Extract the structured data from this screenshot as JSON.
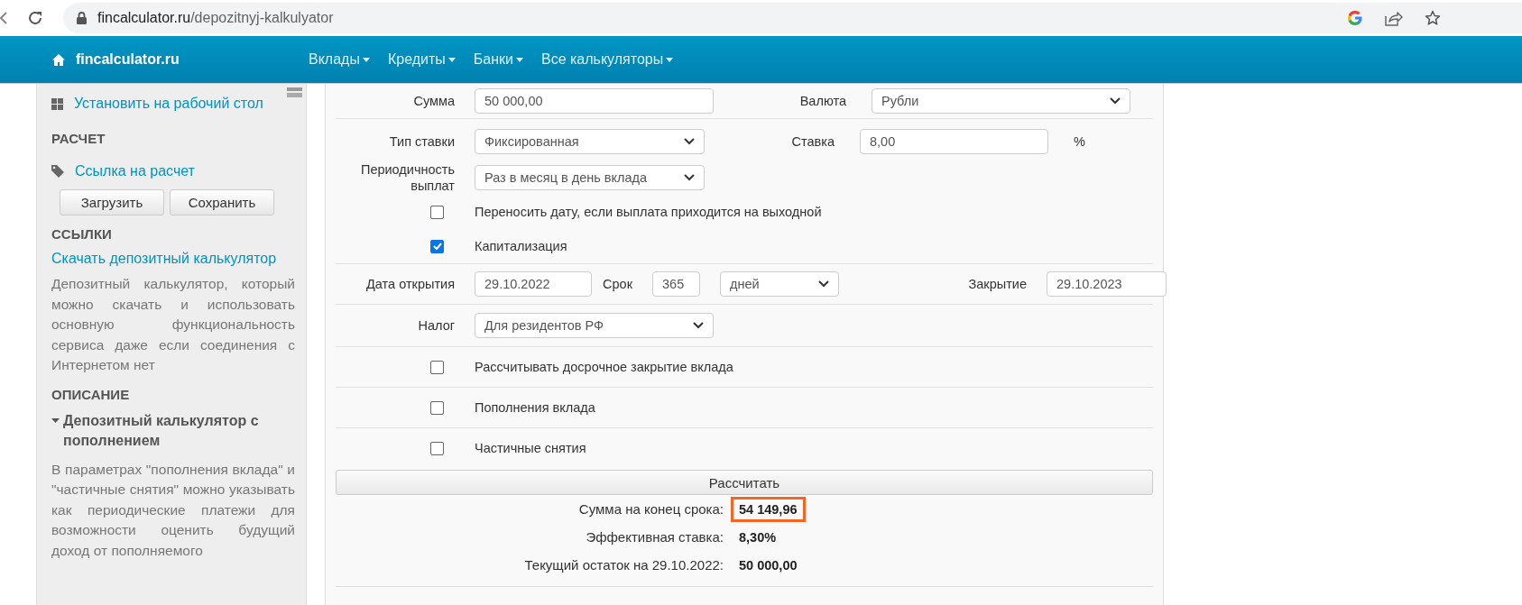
{
  "browser": {
    "url_host": "fincalculator.ru",
    "url_path": "/depozitnyj-kalkulyator"
  },
  "navbar": {
    "brand": "fincalculator.ru",
    "menu": [
      "Вклады",
      "Кредиты",
      "Банки",
      "Все калькуляторы"
    ]
  },
  "sidebar": {
    "install_link": "Установить на рабочий стол",
    "calc_heading": "РАСЧЕТ",
    "calc_link": "Ссылка на расчет",
    "buttons": [
      "Загрузить",
      "Сохранить"
    ],
    "links_heading": "ССЫЛКИ",
    "download_link": "Скачать депозитный калькулятор",
    "download_text": "Депозитный калькулятор, который можно скачать и использовать основную функциональность сервиса даже если соединения с Интернетом нет",
    "desc_heading": "ОПИСАНИЕ",
    "desc_title": "Депозитный калькулятор с пополнением",
    "desc_text": "В параметрах \"пополнения вклада\" и \"частичные снятия\" можно указывать как периодические платежи для возможности оценить будущий доход от пополняемого"
  },
  "form": {
    "amount": {
      "label": "Сумма",
      "value": "50 000,00"
    },
    "currency": {
      "label": "Валюта",
      "value": "Рубли"
    },
    "rate_type": {
      "label": "Тип ставки",
      "value": "Фиксированная"
    },
    "rate": {
      "label": "Ставка",
      "value": "8,00",
      "unit": "%"
    },
    "payout": {
      "label": "Периодичность выплат",
      "value": "Раз в месяц в день вклада"
    },
    "options": [
      {
        "label": "Переносить дату, если выплата приходится на выходной",
        "checked": false
      },
      {
        "label": "Капитализация",
        "checked": true
      }
    ],
    "open_date": {
      "label": "Дата открытия",
      "value": "29.10.2022"
    },
    "term": {
      "label": "Срок",
      "value": "365",
      "unit": "дней"
    },
    "close_date": {
      "label": "Закрытие",
      "value": "29.10.2023"
    },
    "tax": {
      "label": "Налог",
      "value": "Для резидентов РФ"
    },
    "extras": [
      {
        "label": "Рассчитывать досрочное закрытие вклада",
        "checked": false
      },
      {
        "label": "Пополнения вклада",
        "checked": false
      },
      {
        "label": "Частичные снятия",
        "checked": false
      }
    ],
    "submit": "Рассчитать"
  },
  "results": [
    {
      "label": "Сумма на конец срока:",
      "value": "54 149,96",
      "highlighted": true
    },
    {
      "label": "Эффективная ставка:",
      "value": "8,30%",
      "highlighted": false
    },
    {
      "label": "Текущий остаток на 29.10.2022:",
      "value": "50 000,00",
      "highlighted": false
    }
  ]
}
